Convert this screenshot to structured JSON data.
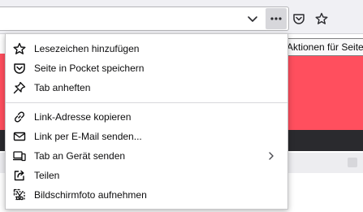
{
  "tooltip": {
    "text": "Aktionen für Seite"
  },
  "toolbar": {
    "icons": [
      "chevron-down-icon",
      "more-actions-icon",
      "pocket-icon",
      "star-icon"
    ]
  },
  "menu": {
    "group1": [
      {
        "label": "Lesezeichen hinzufügen",
        "icon": "star-icon"
      },
      {
        "label": "Seite in Pocket speichern",
        "icon": "pocket-icon"
      },
      {
        "label": "Tab anheften",
        "icon": "pin-icon"
      }
    ],
    "group2": [
      {
        "label": "Link-Adresse kopieren",
        "icon": "link-icon"
      },
      {
        "label": "Link per E-Mail senden...",
        "icon": "mail-icon"
      },
      {
        "label": "Tab an Gerät senden",
        "icon": "device-icon",
        "submenu": true
      },
      {
        "label": "Teilen",
        "icon": "share-icon"
      },
      {
        "label": "Bildschirmfoto aufnehmen",
        "icon": "screenshot-icon"
      }
    ]
  },
  "colors": {
    "hero": "#ff4f5e",
    "dark_band": "#2a2a2e",
    "toolbar": "#f0f0f4"
  }
}
